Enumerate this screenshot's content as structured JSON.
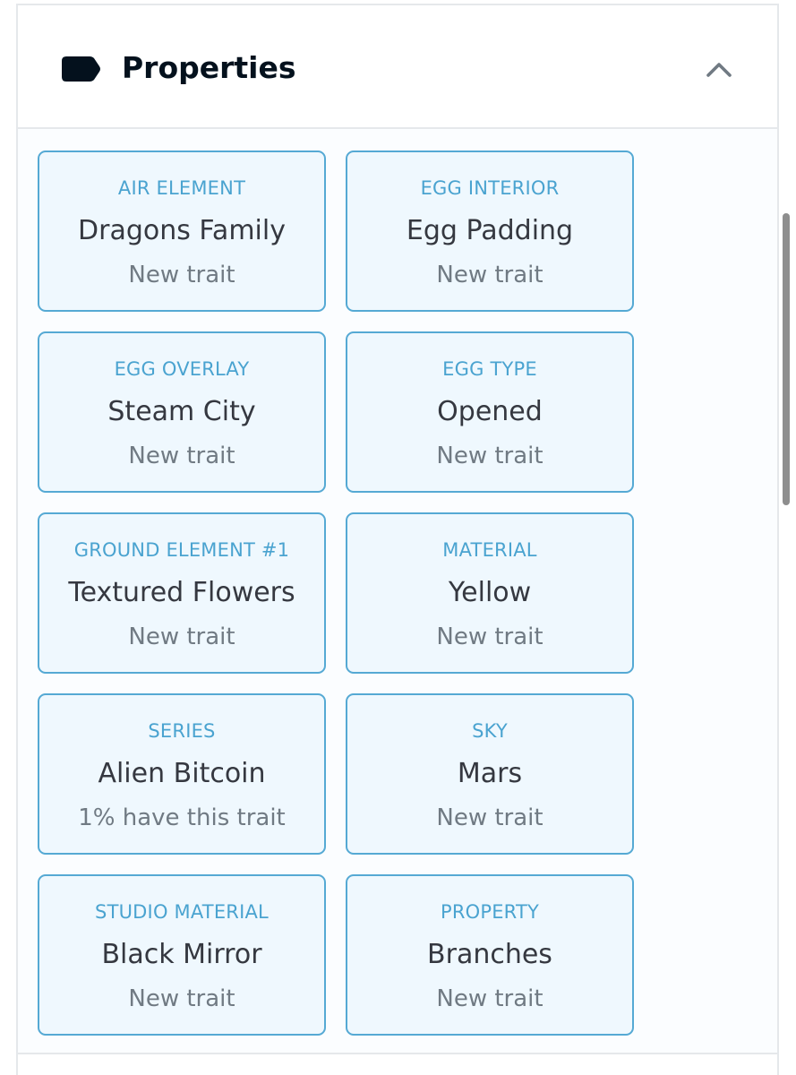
{
  "section": {
    "title": "Properties",
    "icon": "tag-icon",
    "toggle_icon": "chevron-up-icon"
  },
  "properties": [
    {
      "type": "AIR ELEMENT",
      "value": "Dragons Family",
      "rarity": "New trait"
    },
    {
      "type": "EGG INTERIOR",
      "value": "Egg Padding",
      "rarity": "New trait"
    },
    {
      "type": "EGG OVERLAY",
      "value": "Steam City",
      "rarity": "New trait"
    },
    {
      "type": "EGG TYPE",
      "value": "Opened",
      "rarity": "New trait"
    },
    {
      "type": "GROUND ELEMENT #1",
      "value": "Textured Flowers",
      "rarity": "New trait"
    },
    {
      "type": "MATERIAL",
      "value": "Yellow",
      "rarity": "New trait"
    },
    {
      "type": "SERIES",
      "value": "Alien Bitcoin",
      "rarity": "1% have this trait"
    },
    {
      "type": "SKY",
      "value": "Mars",
      "rarity": "New trait"
    },
    {
      "type": "STUDIO MATERIAL",
      "value": "Black Mirror",
      "rarity": "New trait"
    },
    {
      "type": "PROPERTY",
      "value": "Branches",
      "rarity": "New trait"
    }
  ],
  "colors": {
    "card_border": "#55a9d4",
    "card_background": "#eff8fe",
    "trait_type": "#4aa3d0",
    "trait_value": "#353840",
    "rarity_text": "#707a83",
    "title_text": "#04111d"
  }
}
